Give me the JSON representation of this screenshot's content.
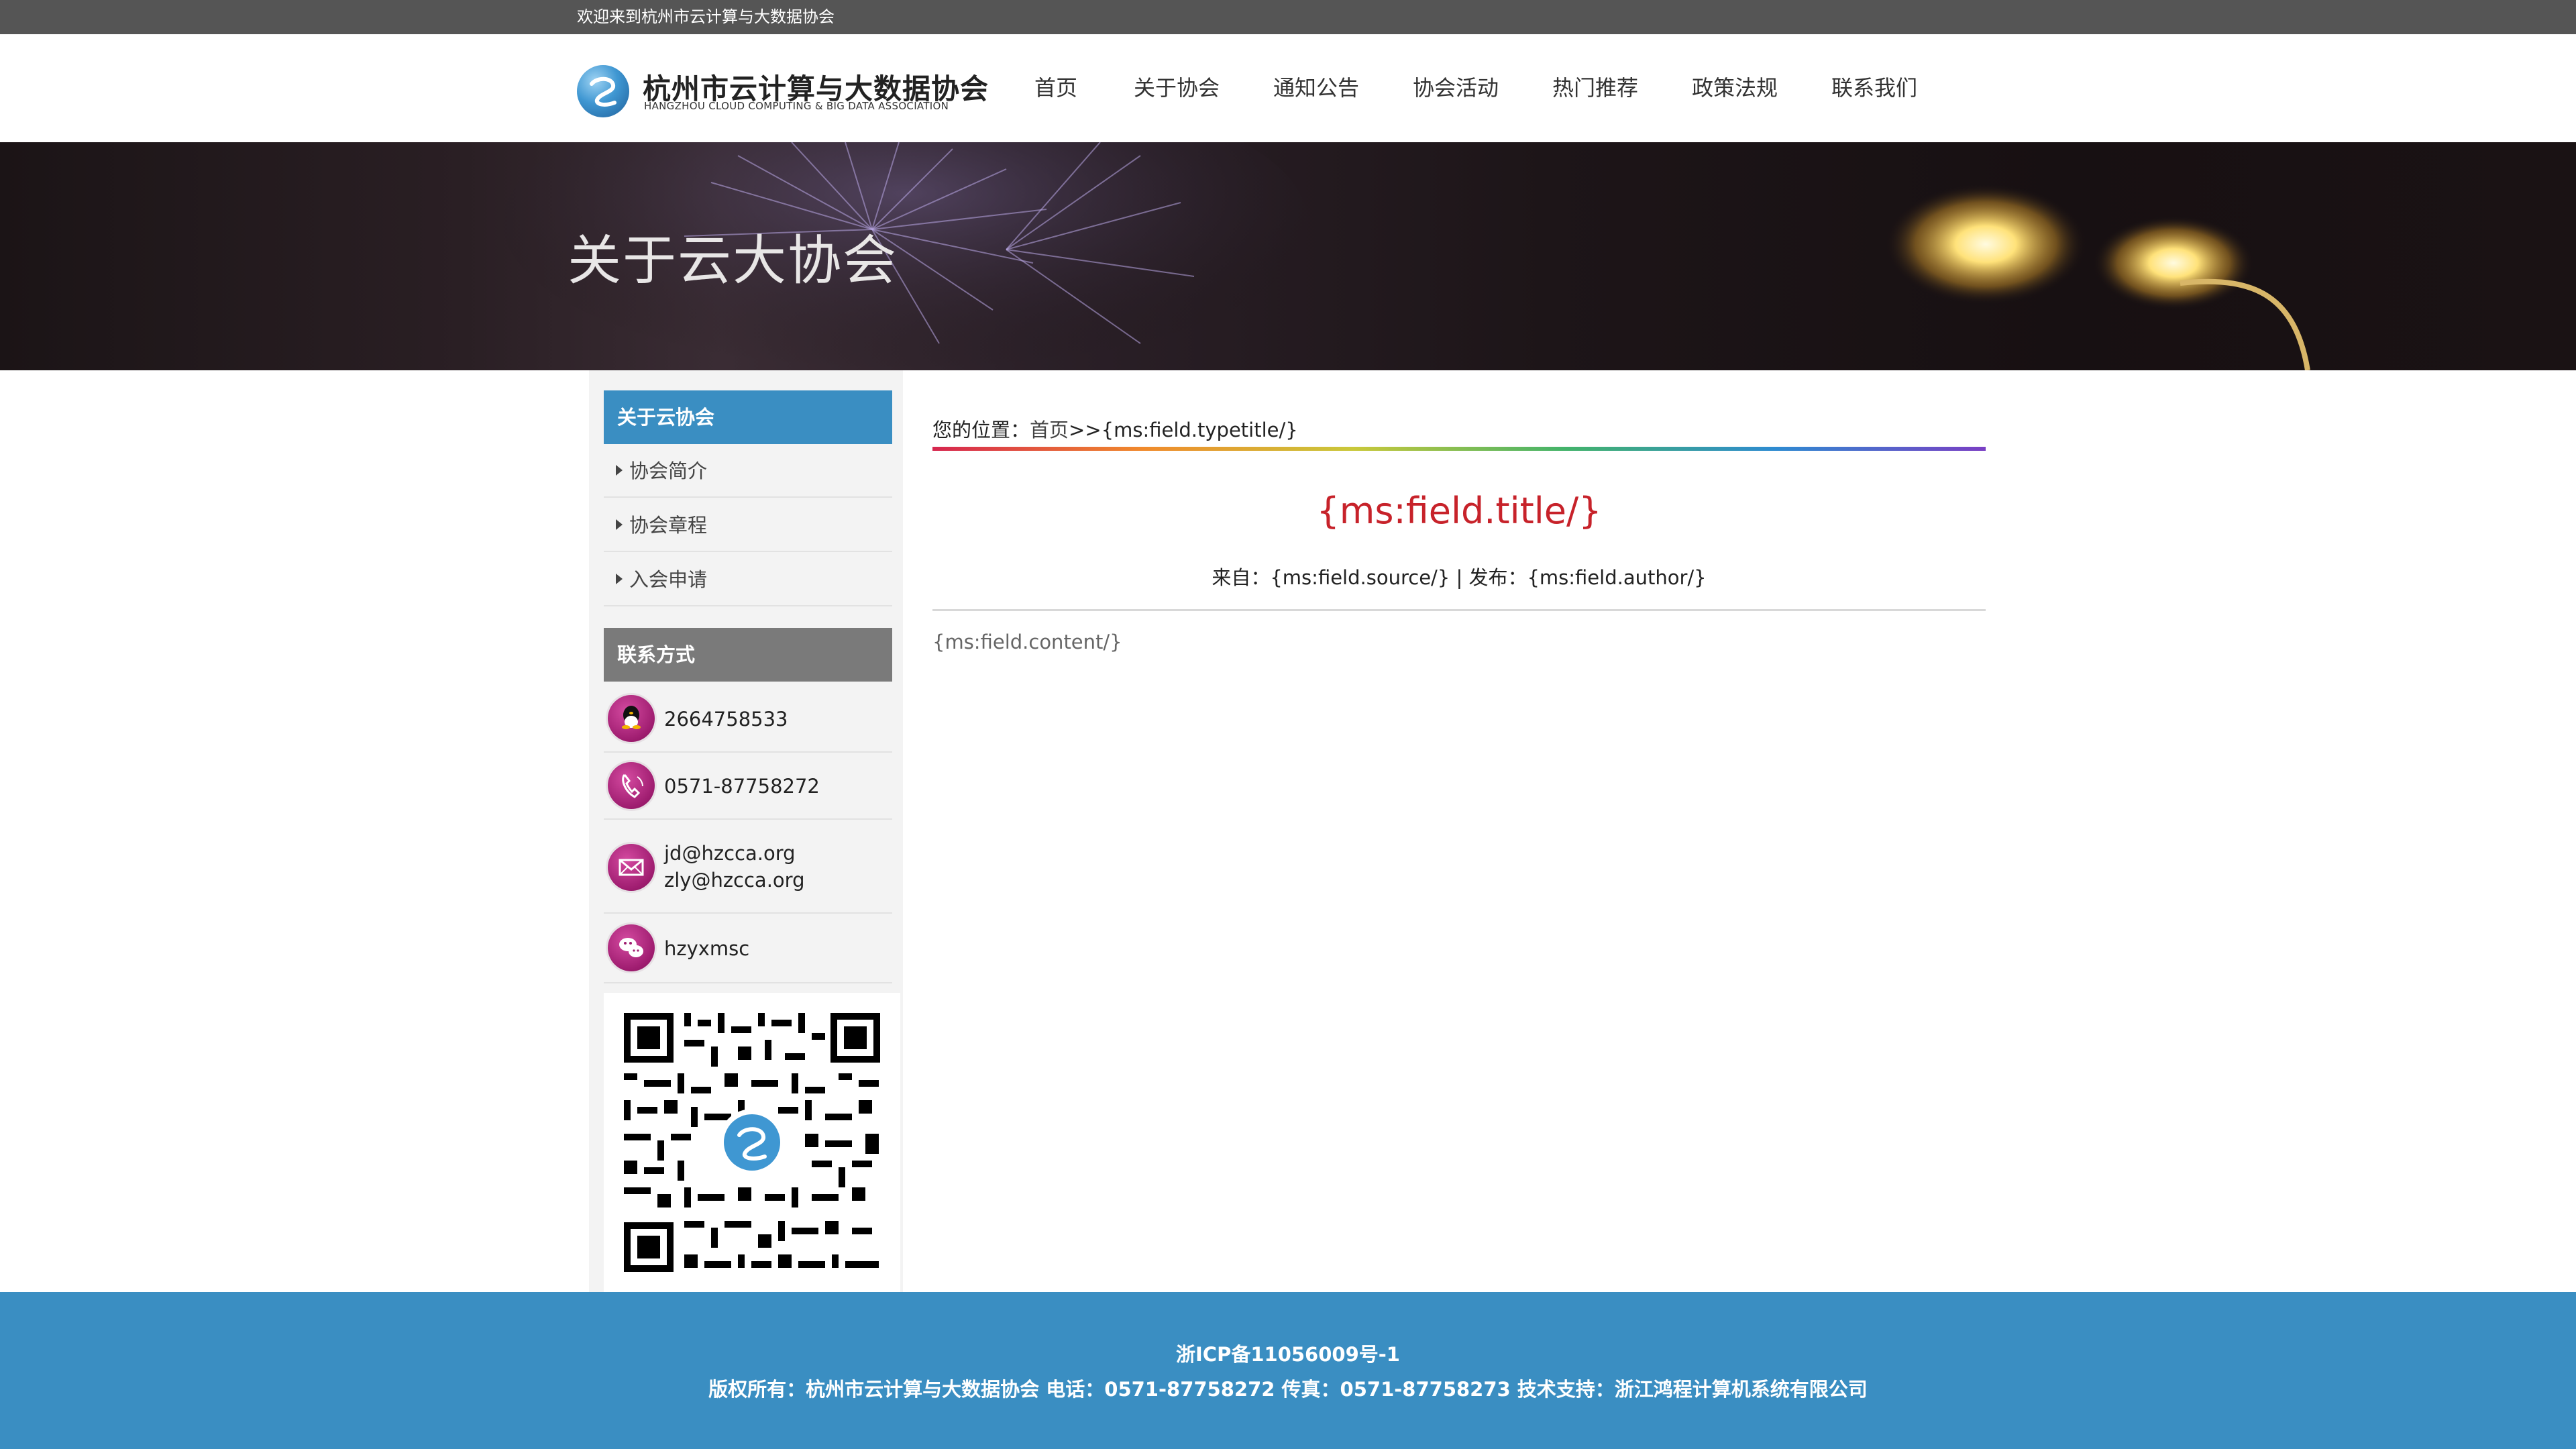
{
  "topbar": {
    "welcome": "欢迎来到杭州市云计算与大数据协会"
  },
  "logo": {
    "cn": "杭州市云计算与大数据协会",
    "en": "HANGZHOU CLOUD COMPUTING & BIG DATA ASSOCIATION"
  },
  "nav": {
    "items": [
      {
        "label": "首页"
      },
      {
        "label": "关于协会"
      },
      {
        "label": "通知公告"
      },
      {
        "label": "协会活动"
      },
      {
        "label": "热门推荐"
      },
      {
        "label": "政策法规"
      },
      {
        "label": "联系我们"
      }
    ]
  },
  "banner": {
    "title": "关于云大协会"
  },
  "sidebar": {
    "section_title": "关于云协会",
    "links": [
      {
        "label": "协会简介"
      },
      {
        "label": "协会章程"
      },
      {
        "label": "入会申请"
      }
    ],
    "contact_title": "联系方式",
    "contacts": {
      "qq": "2664758533",
      "phone": "0571-87758272",
      "email1": "jd@hzcca.org",
      "email2": "zly@hzcca.org",
      "wechat": "hzyxmsc"
    },
    "icons": {
      "qq": "qq-icon",
      "phone": "phone-icon",
      "email": "mail-icon",
      "wechat": "wechat-icon"
    }
  },
  "content": {
    "breadcrumb_prefix": "您的位置：",
    "breadcrumb_home": "首页",
    "breadcrumb_sep": ">>",
    "breadcrumb_current": "{ms:field.typetitle/}",
    "title": "{ms:field.title/}",
    "meta": "来自：{ms:field.source/} | 发布：{ms:field.author/}",
    "body": "{ms:field.content/}"
  },
  "footer": {
    "icp": "浙ICP备11056009号-1",
    "copyright": "版权所有：杭州市云计算与大数据协会 电话：0571-87758272 传真：0571-87758273 技术支持：浙江鸿程计算机系统有限公司"
  },
  "colors": {
    "topbar": "#555555",
    "accent_blue": "#3a8ec2",
    "title_red": "#c7222a",
    "contact_icon": "#9e1c6f"
  }
}
